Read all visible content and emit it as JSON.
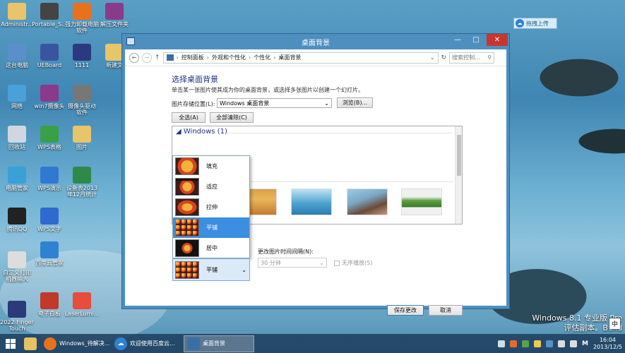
{
  "desktop": {
    "icons": [
      {
        "label": "Administr...",
        "icon": "user-folder-icon"
      },
      {
        "label": "Portable_S...",
        "icon": "terminal-icon"
      },
      {
        "label": "强力卸载电脑\n软件",
        "icon": "uninstall-icon"
      },
      {
        "label": "解压文件夹",
        "icon": "winrar-icon"
      },
      {
        "label": "这台电脑",
        "icon": "computer-icon"
      },
      {
        "label": "UEBoard",
        "icon": "edit-icon"
      },
      {
        "label": "1111",
        "icon": "video-icon"
      },
      {
        "label": "新建文",
        "icon": "folder-icon"
      },
      {
        "label": "网络",
        "icon": "network-icon"
      },
      {
        "label": "win7摄像头",
        "icon": "winrar-icon"
      },
      {
        "label": "摄像头驱动\n软件",
        "icon": "camera-icon"
      },
      {
        "label": "回收站",
        "icon": "recycle-bin-icon"
      },
      {
        "label": "WPS表格",
        "icon": "wps-sheet-icon"
      },
      {
        "label": "图片",
        "icon": "folder-icon"
      },
      {
        "label": "电脑管家",
        "icon": "shield-icon"
      },
      {
        "label": "WPS演示",
        "icon": "wps-slides-icon"
      },
      {
        "label": "设备表2013\n年12月统计",
        "icon": "excel-icon"
      },
      {
        "label": "腾讯QQ",
        "icon": "qq-icon"
      },
      {
        "label": "WPS文字",
        "icon": "wps-writer-icon"
      },
      {
        "label": "百度云管家",
        "icon": "baidu-cloud-icon"
      },
      {
        "label": "自定义打印\n机器输入",
        "icon": "printer-icon"
      },
      {
        "label": "电子白板",
        "icon": "whiteboard-icon"
      },
      {
        "label": "LaserLumi...",
        "icon": "laser-icon"
      },
      {
        "label": "2022 Finger\nTouch",
        "icon": "touch-icon"
      }
    ],
    "baidu_btn": "拖拽上传"
  },
  "window": {
    "title": "桌面背景",
    "controls": {
      "minimize": "—",
      "maximize": "□",
      "close": "✕"
    },
    "breadcrumb": [
      "控制面板",
      "外观和个性化",
      "个性化",
      "桌面背景"
    ],
    "search_placeholder": "搜索控制...",
    "heading": "选择桌面背景",
    "description": "单击某一张图片使其成为你的桌面背景，或选择多张图片以创建一个幻灯片。",
    "location_label": "图片存储位置(L):",
    "location_value": "Windows 桌面背景",
    "browse_label": "浏览(B)...",
    "select_all": "全选(A)",
    "clear_all": "全部清除(C)",
    "group_title": "Windows (1)",
    "position_options": [
      "填充",
      "适应",
      "拉伸",
      "平铺",
      "居中"
    ],
    "selected_position": "平铺",
    "interval_label": "更改图片时间间隔(N):",
    "interval_value": "30 分钟",
    "shuffle_label": "无序播放(S)",
    "save_label": "保存更改",
    "cancel_label": "取消"
  },
  "taskbar": {
    "items": [
      {
        "label": "Windows_待解决..."
      },
      {
        "label": "欢迎使用百度云..."
      },
      {
        "label": "桌面背景"
      }
    ],
    "ime": "中",
    "time": "16:04",
    "date": "2013/12/5"
  },
  "watermark": {
    "line1": "Windows 8.1 专业版 Pre",
    "line2": "评估副本。Build"
  }
}
